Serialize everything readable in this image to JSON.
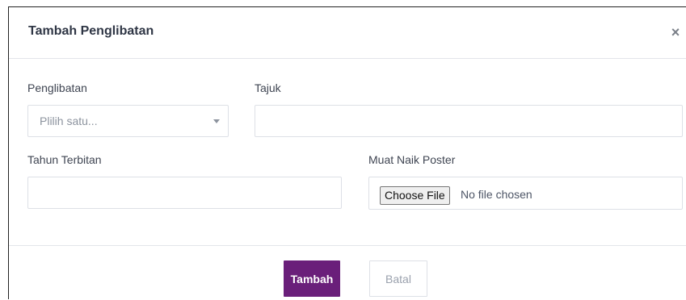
{
  "modal": {
    "title": "Tambah Penglibatan",
    "close_glyph": "×"
  },
  "form": {
    "penglibatan": {
      "label": "Penglibatan",
      "placeholder": "Plilih satu..."
    },
    "tajuk": {
      "label": "Tajuk",
      "value": ""
    },
    "tahun_terbitan": {
      "label": "Tahun Terbitan",
      "value": ""
    },
    "poster": {
      "label": "Muat Naik Poster",
      "button_label": "Choose File",
      "status": "No file chosen"
    }
  },
  "footer": {
    "submit_label": "Tambah",
    "cancel_label": "Batal"
  },
  "colors": {
    "primary": "#6a1f7a",
    "text": "#3f4552",
    "border": "#dde0e6"
  },
  "icons": {
    "close": "close-icon",
    "dropdown": "caret-down-icon"
  }
}
